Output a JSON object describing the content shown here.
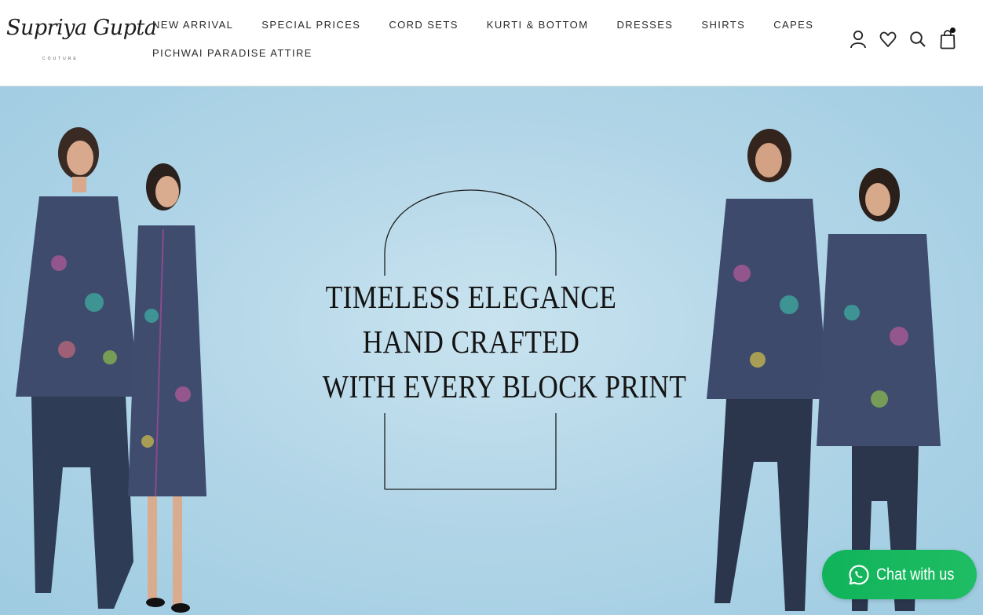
{
  "brand": {
    "name": "Supriya Gupta",
    "tagline": "COUTURE"
  },
  "nav": {
    "items": [
      {
        "label": "NEW ARRIVAL"
      },
      {
        "label": "SPECIAL PRICES"
      },
      {
        "label": "CORD SETS"
      },
      {
        "label": "KURTI & BOTTOM"
      },
      {
        "label": "DRESSES"
      },
      {
        "label": "SHIRTS"
      },
      {
        "label": "CAPES"
      },
      {
        "label": "PICHWAI PARADISE ATTIRE"
      }
    ]
  },
  "header_icons": [
    "user-icon",
    "heart-icon",
    "search-icon",
    "shopping-bag-icon"
  ],
  "hero": {
    "lines": [
      "TIMELESS ELEGANCE",
      "HAND CRAFTED",
      "WITH EVERY BLOCK PRINT"
    ],
    "background_color": "#b3d6e8",
    "garment_color": "#3d4a6b"
  },
  "chat": {
    "label": "Chat with us",
    "icon": "whatsapp-icon",
    "color": "#1cb860"
  }
}
